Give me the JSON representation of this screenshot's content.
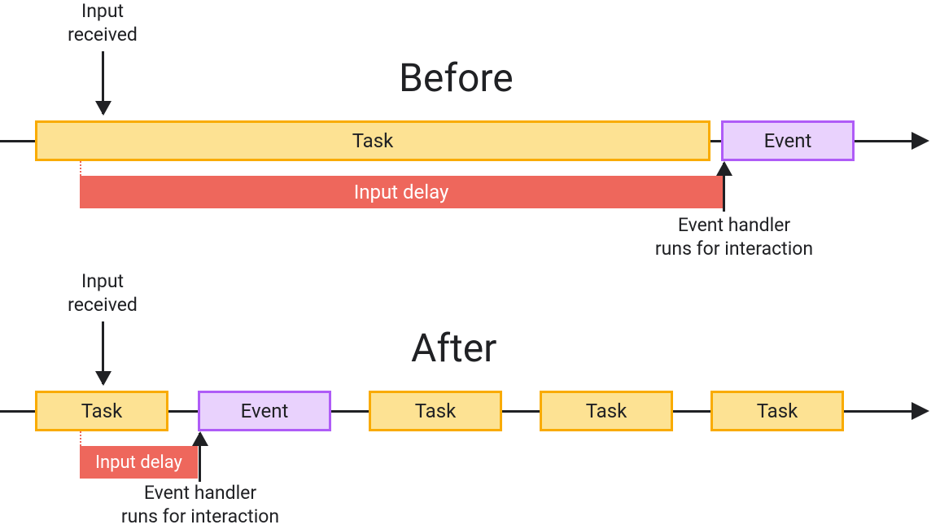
{
  "before": {
    "title": "Before",
    "input_received_label": "Input\nreceived",
    "task_label": "Task",
    "event_label": "Event",
    "delay_label": "Input delay",
    "handler_label": "Event handler\nruns for interaction"
  },
  "after": {
    "title": "After",
    "input_received_label": "Input\nreceived",
    "task_labels": [
      "Task",
      "Task",
      "Task",
      "Task"
    ],
    "event_label": "Event",
    "delay_label": "Input delay",
    "handler_label": "Event handler\nruns for interaction"
  },
  "colors": {
    "task_fill": "#fde293",
    "task_border": "#f9ab00",
    "event_fill": "#e9d2fd",
    "event_border": "#af5cf7",
    "delay_fill": "#ee675c",
    "text": "#202124"
  }
}
